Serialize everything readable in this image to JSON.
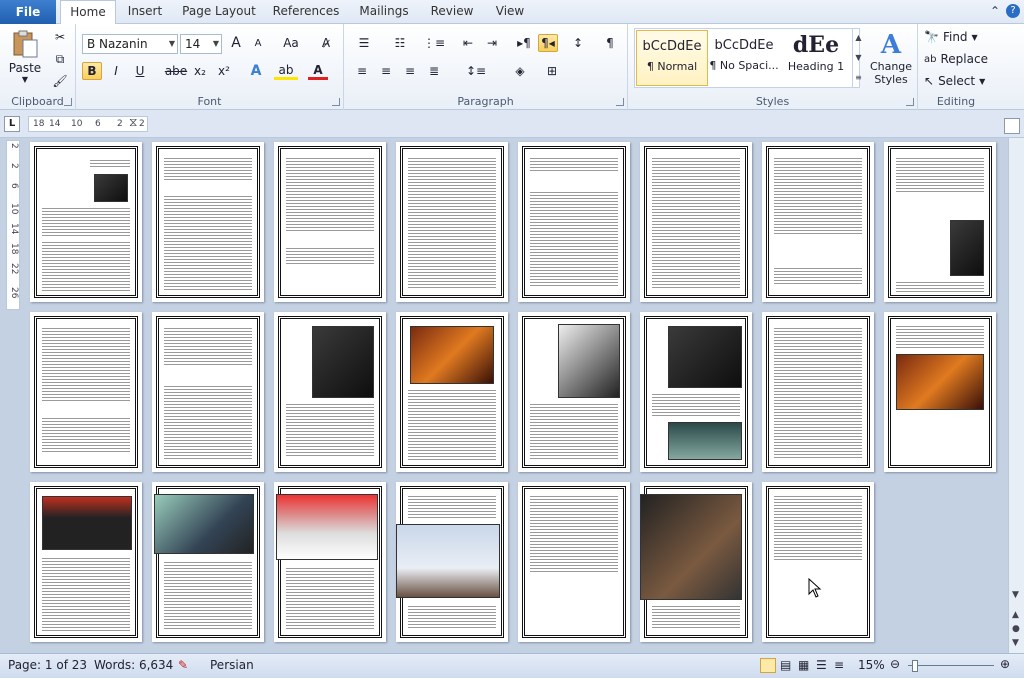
{
  "tabs": {
    "file": "File",
    "items": [
      {
        "label": "Home"
      },
      {
        "label": "Insert"
      },
      {
        "label": "Page Layout"
      },
      {
        "label": "References"
      },
      {
        "label": "Mailings"
      },
      {
        "label": "Review"
      },
      {
        "label": "View"
      }
    ]
  },
  "clipboard": {
    "paste": "Paste",
    "label": "Clipboard"
  },
  "font": {
    "name": "B Nazanin",
    "size": "14",
    "label": "Font",
    "bold": "B",
    "italic": "I",
    "underline": "U",
    "strike": "abe",
    "subscript": "x₂",
    "superscript": "x²",
    "case": "Aa",
    "grow": "A",
    "shrink": "A",
    "effects": "A",
    "highlight": "ab",
    "color": "A"
  },
  "paragraph": {
    "label": "Paragraph"
  },
  "styles": {
    "label": "Styles",
    "cards": [
      {
        "sample": "bCcDdEe",
        "name": "¶ Normal"
      },
      {
        "sample": "bCcDdEe",
        "name": "¶ No Spaci..."
      },
      {
        "sample": "dEe",
        "name": "Heading 1"
      }
    ],
    "change": "Change Styles"
  },
  "editing": {
    "label": "Editing",
    "find": "Find",
    "replace": "Replace",
    "select": "Select"
  },
  "ruler": {
    "corner": "L",
    "ticks": [
      "18",
      "14",
      "10",
      "6",
      "2",
      "2"
    ],
    "vticks": [
      "2",
      "2",
      "6",
      "10",
      "14",
      "18",
      "22",
      "26"
    ]
  },
  "statusbar": {
    "page": "Page: 1 of 23",
    "words": "Words: 6,634",
    "language": "Persian",
    "zoom": "15%"
  },
  "colors": {
    "accent": "#2b5797",
    "file_tab": "#2a6bc1",
    "workspace": "#c4d1e2"
  }
}
